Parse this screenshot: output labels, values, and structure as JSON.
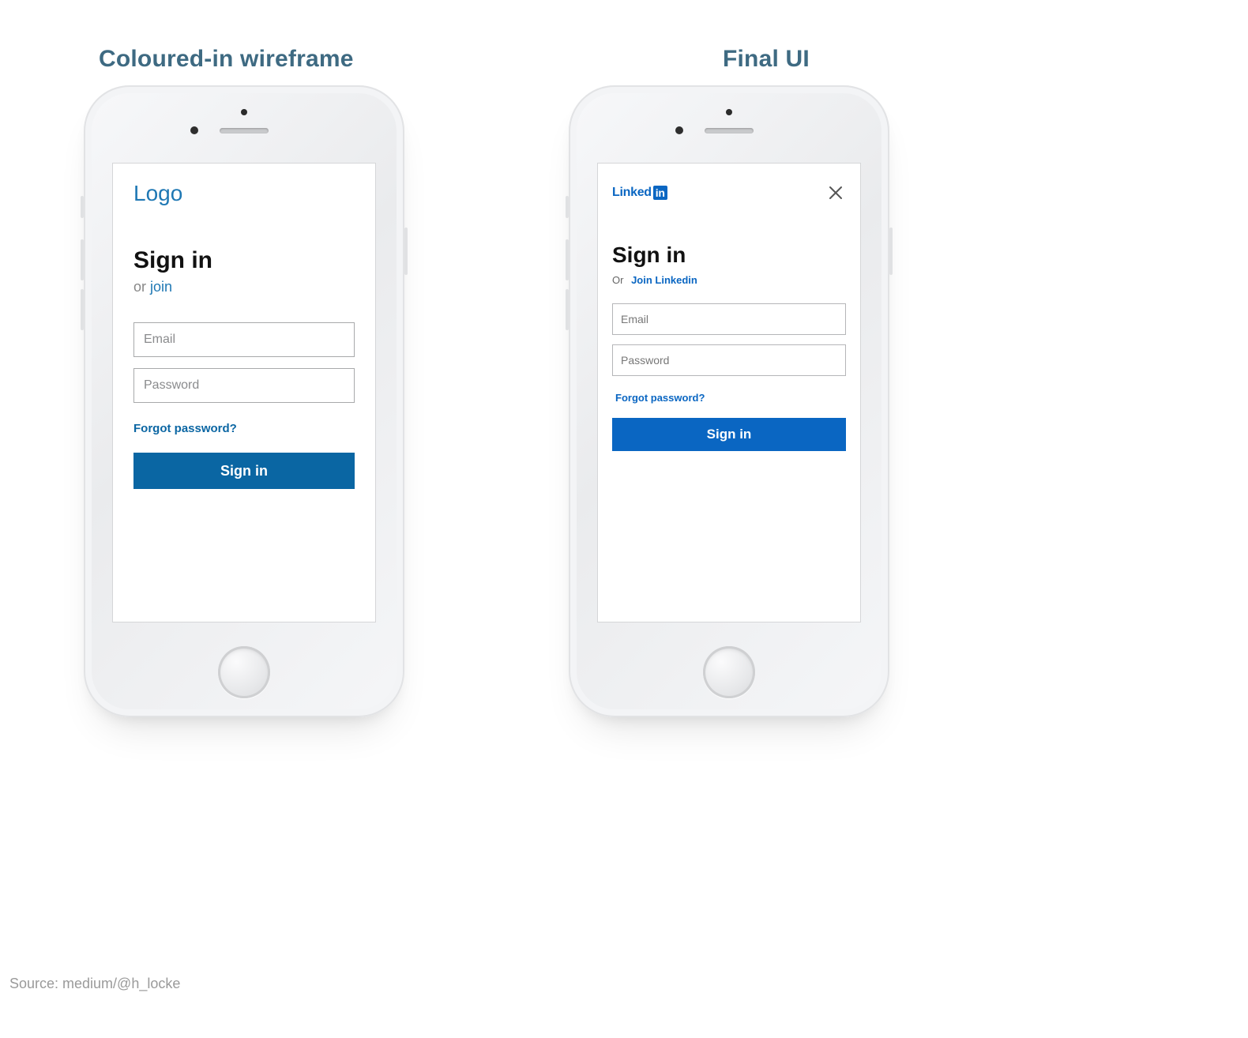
{
  "headings": {
    "left": "Coloured-in wireframe",
    "right": "Final UI"
  },
  "wireframe": {
    "logo_text": "Logo",
    "title": "Sign in",
    "sub_prefix": "or ",
    "sub_link": "join",
    "email_placeholder": "Email",
    "password_placeholder": "Password",
    "forgot": "Forgot password?",
    "signin_button": "Sign in"
  },
  "final": {
    "logo_linked": "Linked",
    "logo_in": "in",
    "title": "Sign in",
    "sub_prefix": "Or",
    "sub_link": "Join Linkedin",
    "email_placeholder": "Email",
    "password_placeholder": "Password",
    "forgot": "Forgot password?",
    "signin_button": "Sign in"
  },
  "source_line": "Source: medium/@h_locke"
}
